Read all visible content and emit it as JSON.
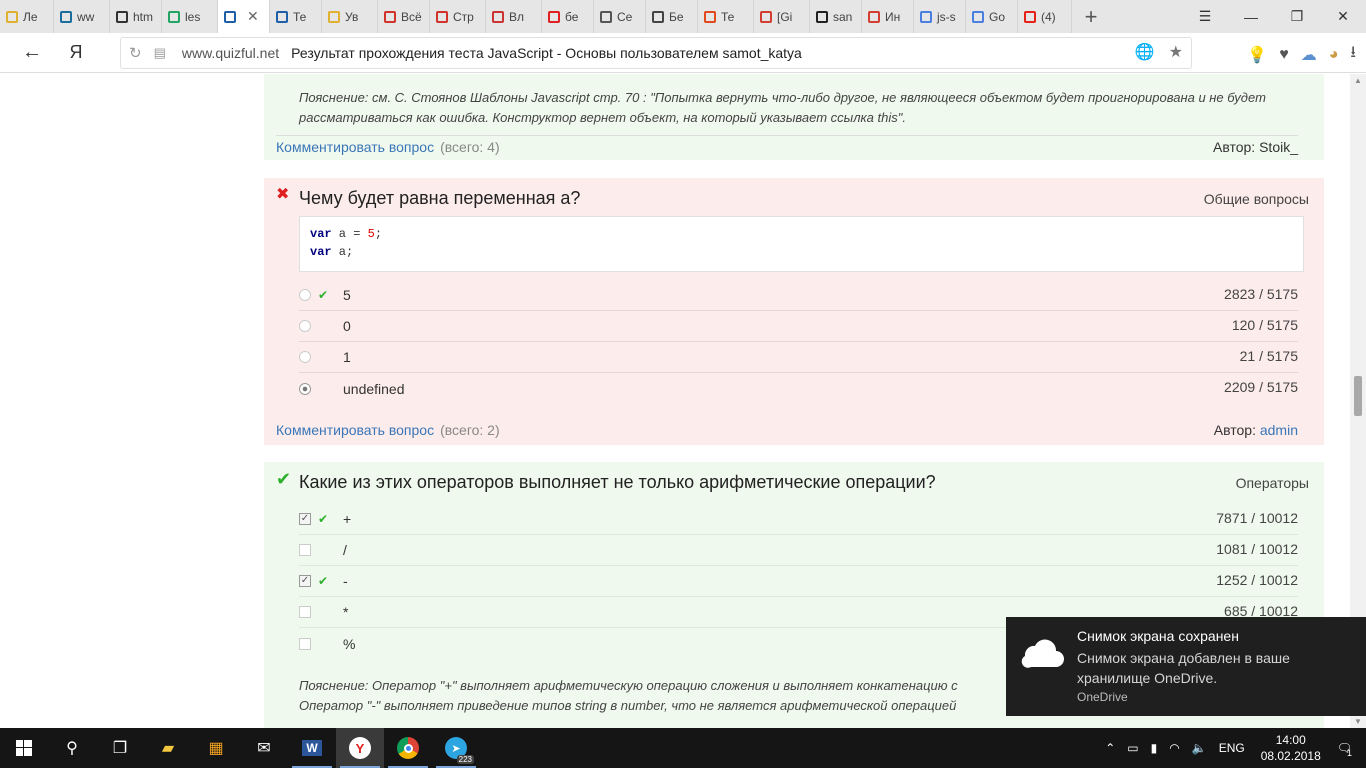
{
  "browser": {
    "tabs": [
      {
        "label": "Ле",
        "icon": "bulb-icon",
        "color": "#e0b030"
      },
      {
        "label": "ww",
        "icon": "cisco-icon",
        "color": "#1a6e9e"
      },
      {
        "label": "htm",
        "icon": "shield-icon",
        "color": "#333333"
      },
      {
        "label": "les",
        "icon": "drive-icon",
        "color": "#1fa463"
      },
      {
        "label": "",
        "icon": "quizful-icon",
        "color": "#1f5fa8"
      },
      {
        "label": "Те",
        "icon": "quizful-icon",
        "color": "#1f5fa8"
      },
      {
        "label": "Ув",
        "icon": "bulb-icon",
        "color": "#e0b030"
      },
      {
        "label": "Всё",
        "icon": "figure-icon",
        "color": "#d0342c"
      },
      {
        "label": "Стр",
        "icon": "figure-icon",
        "color": "#d0342c"
      },
      {
        "label": "Вл",
        "icon": "youtube-tv-icon",
        "color": "#cc3333"
      },
      {
        "label": "бе",
        "icon": "yandex-icon",
        "color": "#e02020"
      },
      {
        "label": "Се",
        "icon": "document-icon",
        "color": "#555555"
      },
      {
        "label": "Бе",
        "icon": "film-icon",
        "color": "#444444"
      },
      {
        "label": "Те",
        "icon": "ph-icon",
        "color": "#e04a1c"
      },
      {
        "label": "[Gi",
        "icon": "gmail-icon",
        "color": "#d23f31"
      },
      {
        "label": "san",
        "icon": "github-icon",
        "color": "#222222"
      },
      {
        "label": "Ин",
        "icon": "gmail-icon",
        "color": "#d23f31"
      },
      {
        "label": "js-s",
        "icon": "docs-icon",
        "color": "#4a7fe0"
      },
      {
        "label": "Go",
        "icon": "translate-icon",
        "color": "#4a7fe0"
      },
      {
        "label": "(4)",
        "icon": "youtube-icon",
        "color": "#e62117"
      }
    ],
    "active_tab_index": 4,
    "new_tab_glyph": "+",
    "window_controls": {
      "menu": "☰",
      "minimize": "—",
      "restore": "❐",
      "close": "✕"
    },
    "nav": {
      "back": "←",
      "home": "Я",
      "reload": "↻"
    },
    "url_domain": "www.quizful.net",
    "page_title": "Результат прохождения теста JavaScript - Основы пользователем samot_katya"
  },
  "page": {
    "q_prev": {
      "explanation": "Пояснение: см. С. Стоянов Шаблоны Javascript стр. 70 : \"Попытка вернуть что-либо другое, не являющееся объектом будет проигнорирована и не будет рассматриваться как ошибка. Конструктор вернет объект, на который указывает ссылка this\".",
      "comment_link": "Комментировать вопрос",
      "comment_count": "(всего: 4)",
      "author_label": "Автор: Stoik_"
    },
    "q_var": {
      "status": "wrong",
      "status_glyph": "✖",
      "title": "Чему будет равна переменная a?",
      "category": "Общие вопросы",
      "code_line1_kw": "var",
      "code_line1_rest": " a = ",
      "code_line1_num": "5",
      "code_line1_end": ";",
      "code_line2_kw": "var",
      "code_line2_rest": " a;",
      "answers": [
        {
          "text": "5",
          "stat": "2823 / 5175",
          "correct": true,
          "selected": false
        },
        {
          "text": "0",
          "stat": "120 / 5175",
          "correct": false,
          "selected": false
        },
        {
          "text": "1",
          "stat": "21 / 5175",
          "correct": false,
          "selected": false
        },
        {
          "text": "undefined",
          "stat": "2209 / 5175",
          "correct": false,
          "selected": true
        }
      ],
      "comment_link": "Комментировать вопрос",
      "comment_count": "(всего: 2)",
      "author_prefix": "Автор: ",
      "author_name": "admin"
    },
    "q_ops": {
      "status": "right",
      "status_glyph": "✔",
      "title": "Какие из этих операторов выполняет не только арифметические операции?",
      "category": "Операторы",
      "answers": [
        {
          "text": "+",
          "stat": "7871 / 10012",
          "correct": true,
          "selected": true
        },
        {
          "text": "/",
          "stat": "1081 / 10012",
          "correct": false,
          "selected": false
        },
        {
          "text": "-",
          "stat": "1252 / 10012",
          "correct": true,
          "selected": true
        },
        {
          "text": "*",
          "stat": "685 / 10012",
          "correct": false,
          "selected": false
        },
        {
          "text": "%",
          "stat": "",
          "correct": false,
          "selected": false
        }
      ],
      "explanation_line1": "Пояснение: Оператор \"+\" выполняет арифметическую операцию сложения и выполняет конкатенацию с",
      "explanation_line2": "Оператор \"-\" выполняет приведение типов string в number, что не является арифметической операцией"
    }
  },
  "toast": {
    "title": "Снимок экрана сохранен",
    "body": "Снимок экрана добавлен в ваше хранилище OneDrive.",
    "source": "OneDrive"
  },
  "taskbar": {
    "clock_time": "14:00",
    "clock_date": "08.02.2018",
    "language": "ENG",
    "telegram_badge": "223",
    "notification_count": "1"
  },
  "colors": {
    "correct_bg": "#f0f9ee",
    "wrong_bg": "#fdecec",
    "link": "#3a76b7",
    "check_green": "#2bb02b",
    "cross_red": "#e02020"
  }
}
